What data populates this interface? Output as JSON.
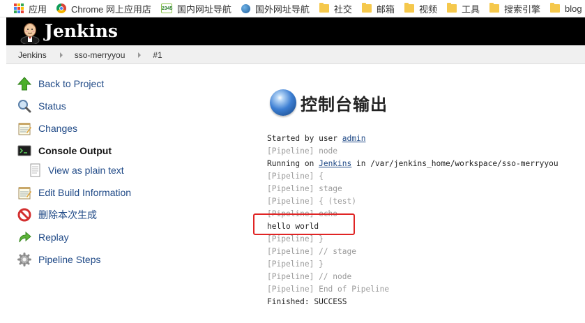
{
  "bookmarks": [
    {
      "label": "应用",
      "icon": "apps-grid-icon"
    },
    {
      "label": "Chrome 网上应用店",
      "icon": "chrome-icon"
    },
    {
      "label": "国内网址导航",
      "icon": "2345-icon"
    },
    {
      "label": "国外网址导航",
      "icon": "globe-icon"
    },
    {
      "label": "社交",
      "icon": "folder-icon"
    },
    {
      "label": "邮箱",
      "icon": "folder-icon"
    },
    {
      "label": "视频",
      "icon": "folder-icon"
    },
    {
      "label": "工具",
      "icon": "folder-icon"
    },
    {
      "label": "搜索引擎",
      "icon": "folder-icon"
    },
    {
      "label": "blog",
      "icon": "folder-icon"
    }
  ],
  "header": {
    "brand": "Jenkins",
    "logo_icon": "jenkins-butler-icon"
  },
  "breadcrumbs": [
    "Jenkins",
    "sso-merryyou",
    "#1"
  ],
  "sidebar": {
    "items": [
      {
        "label": "Back to Project",
        "icon": "up-arrow-icon"
      },
      {
        "label": "Status",
        "icon": "magnifier-icon"
      },
      {
        "label": "Changes",
        "icon": "notepad-icon"
      },
      {
        "label": "Console Output",
        "icon": "terminal-icon",
        "active": true
      },
      {
        "label": "View as plain text",
        "icon": "document-icon",
        "sub": true
      },
      {
        "label": "Edit Build Information",
        "icon": "notepad-icon"
      },
      {
        "label": "删除本次生成",
        "icon": "no-entry-icon"
      },
      {
        "label": "Replay",
        "icon": "replay-arrow-icon"
      },
      {
        "label": "Pipeline Steps",
        "icon": "gear-icon"
      }
    ]
  },
  "main": {
    "title": "控制台输出",
    "title_icon": "blue-ball-icon",
    "console": {
      "started_prefix": "Started by user ",
      "started_user": "admin",
      "line_node": "[Pipeline] node",
      "running_prefix": "Running on ",
      "running_link": "Jenkins",
      "running_suffix": " in /var/jenkins_home/workspace/sso-merryyou",
      "line_open": "[Pipeline] {",
      "line_stage": "[Pipeline] stage",
      "line_stage_open": "[Pipeline] { (test)",
      "line_echo": "[Pipeline] echo",
      "output": "hello world",
      "line_close1": "[Pipeline] }",
      "line_end_stage": "[Pipeline] // stage",
      "line_close2": "[Pipeline] }",
      "line_end_node": "[Pipeline] // node",
      "line_end_pipeline": "[Pipeline] End of Pipeline",
      "finished": "Finished: SUCCESS"
    }
  },
  "colors": {
    "header_bg": "#000000",
    "link": "#204a87",
    "highlight": "#e02424"
  }
}
